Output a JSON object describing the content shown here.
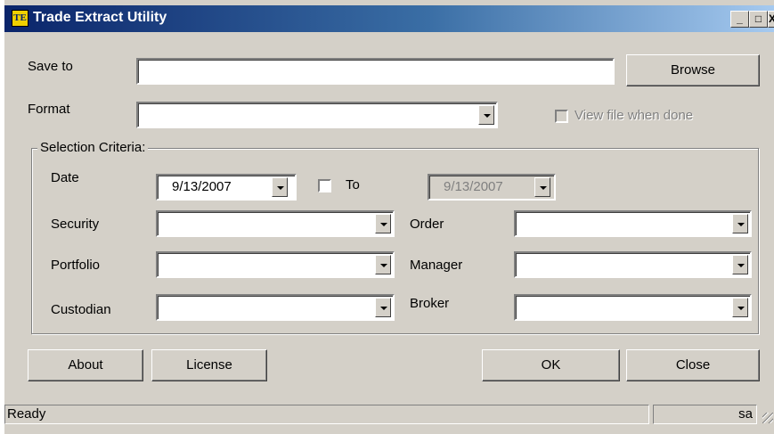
{
  "window": {
    "title": "Trade Extract Utility",
    "icon": "TE",
    "minimize": "_",
    "maximize": "□",
    "close": "X"
  },
  "save_to": {
    "label": "Save to",
    "value": "",
    "browse_label": "Browse"
  },
  "format": {
    "label": "Format",
    "value": "",
    "view_label": "View file when done",
    "view_checked": false,
    "view_enabled": false
  },
  "criteria": {
    "legend": "Selection Criteria:",
    "date_label": "Date",
    "date_value": "9/13/2007",
    "to_label": "To",
    "to_checked": false,
    "to_value": "9/13/2007",
    "security_label": "Security",
    "security_value": "",
    "order_label": "Order",
    "order_value": "",
    "portfolio_label": "Portfolio",
    "portfolio_value": "",
    "manager_label": "Manager",
    "manager_value": "",
    "custodian_label": "Custodian",
    "custodian_value": "",
    "broker_label": "Broker",
    "broker_value": ""
  },
  "buttons": {
    "about": "About",
    "license": "License",
    "ok": "OK",
    "close": "Close"
  },
  "status": {
    "text": "Ready",
    "user": "sa"
  }
}
